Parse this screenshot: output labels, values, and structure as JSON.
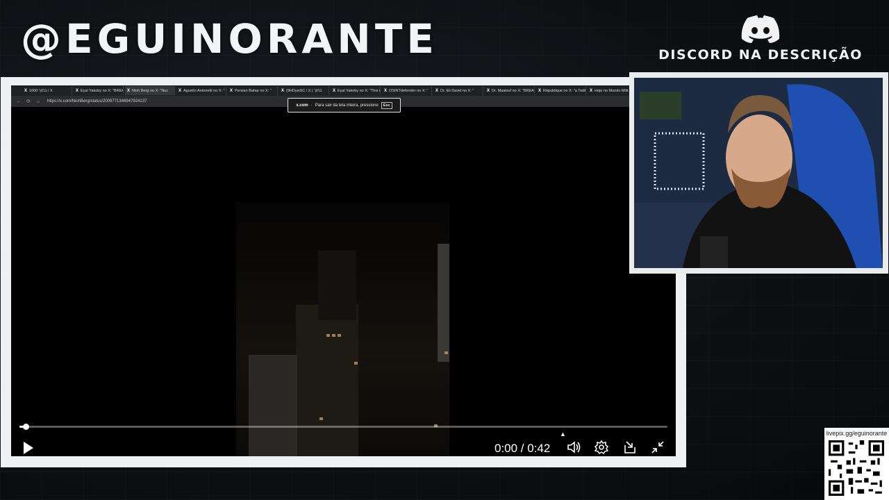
{
  "overlay": {
    "handle": "@EGUINORANTE",
    "discord_text": "DISCORD NA DESCRIÇÃO",
    "discord_icon": "discord-icon",
    "qr_label": "livepix.gg/eguinorante"
  },
  "browser": {
    "tabs": [
      {
        "label": "בתוך 1000 / X",
        "active": false
      },
      {
        "label": "Eyal Yakoby no X: \"BREAK",
        "active": false
      },
      {
        "label": "Nioh Berg no X: \"Nuc",
        "active": true
      },
      {
        "label": "Agustín Antonetti no X: \"",
        "active": false
      },
      {
        "label": "Persian Bahar no X: \"",
        "active": false
      },
      {
        "label": "(9HDywSC / X | בתוך",
        "active": false
      },
      {
        "label": "Eyal Yakoby no X: \"This is",
        "active": false
      },
      {
        "label": "OSINTdefender no X: \"",
        "active": false
      },
      {
        "label": "Dr. Eli David no X: \"",
        "active": false
      },
      {
        "label": "Dr. Maalouf no X: \"BREAK",
        "active": false
      },
      {
        "label": "République no X: \"a Twitt",
        "active": false
      },
      {
        "label": "Hoje no Mundo Milit",
        "active": false
      }
    ],
    "url": "https://x.com/NiohBerg/status/2009771346947924137",
    "fullscreen_notice": {
      "domain": "x.com",
      "message": "Para sair da tela inteira, pressione",
      "key": "Esc"
    }
  },
  "player": {
    "time_display": "0:00 / 0:42",
    "progress": 0.01,
    "icons": {
      "play": "play-icon",
      "volume": "volume-icon",
      "settings": "gear-icon",
      "popout": "popout-icon",
      "exit_fullscreen": "exit-fullscreen-icon"
    }
  },
  "colors": {
    "frame": "#eef0f1",
    "background": "#0d1013",
    "cam_chair": "#1f4fb0"
  }
}
